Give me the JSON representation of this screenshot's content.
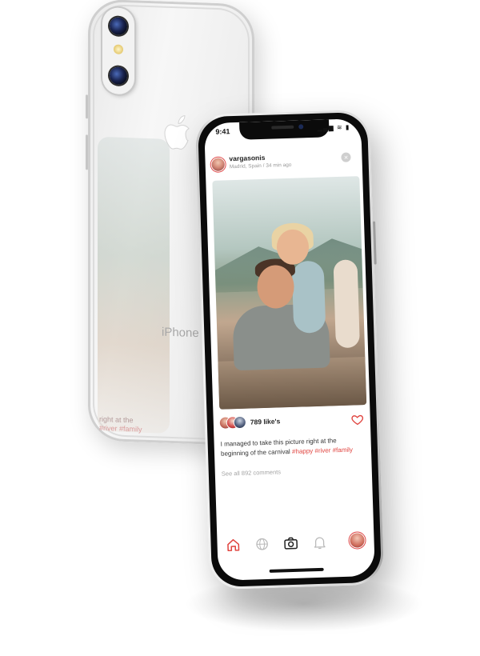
{
  "back_phone": {
    "brand_text": "iPhone",
    "reflection_caption_line1": "right at the",
    "reflection_caption_line2": "#river #family",
    "icons": [
      "apple-logo-icon",
      "camera-lens-icon",
      "flash-icon",
      "heart-outline-icon"
    ]
  },
  "status_bar": {
    "time": "9:41",
    "icons": "▂▄▆ ≋ ▮"
  },
  "post": {
    "username": "vargasonis",
    "location": "Madrid, Spain",
    "separator": "/",
    "time_ago": "34 min ago",
    "close_symbol": "×",
    "likes": "789 like's",
    "caption_text": "I managed to take this picture right at the beginning of the carnival",
    "hashtags": "#happy #river #family",
    "comments_link": "See all 892 comments"
  },
  "tab_bar": {
    "items": [
      "home-icon",
      "globe-icon",
      "camera-icon",
      "bell-icon",
      "profile-avatar"
    ],
    "active": "home-icon"
  },
  "colors": {
    "accent": "#e0433e",
    "text_primary": "#222222",
    "text_muted": "#9a9a9a",
    "device_frame": "#0b0b0b",
    "back_glass": "#f2f2f2"
  }
}
